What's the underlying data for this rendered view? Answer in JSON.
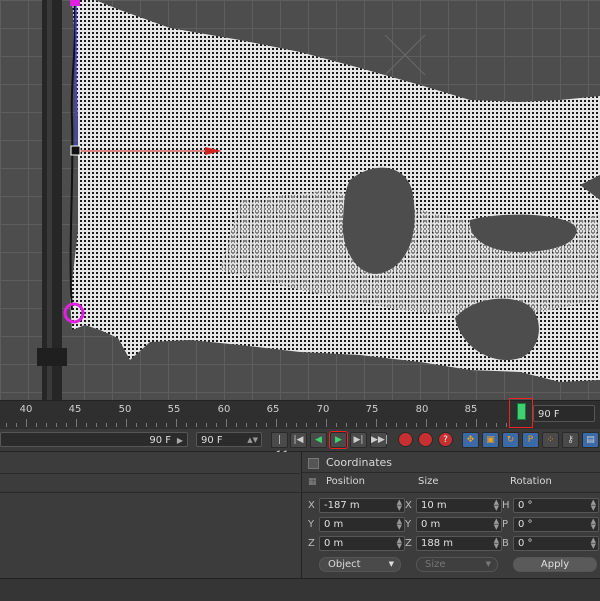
{
  "timeline": {
    "ticks": [
      "40",
      "45",
      "50",
      "55",
      "60",
      "65",
      "70",
      "75",
      "80",
      "85"
    ],
    "end_frame": "90 F"
  },
  "transport": {
    "preview_min": "90 F",
    "preview_max": "90 F"
  },
  "attributes": {
    "title": "Coordinates",
    "col_position": "Position",
    "col_size": "Size",
    "col_rotation": "Rotation",
    "rows": [
      {
        "pos_axis": "X",
        "pos": "-187 m",
        "size_axis": "X",
        "size": "10 m",
        "rot_axis": "H",
        "rot": "0 °"
      },
      {
        "pos_axis": "Y",
        "pos": "0 m",
        "size_axis": "Y",
        "size": "0 m",
        "rot_axis": "P",
        "rot": "0 °"
      },
      {
        "pos_axis": "Z",
        "pos": "0 m",
        "size_axis": "Z",
        "size": "188 m",
        "rot_axis": "B",
        "rot": "0 °"
      }
    ],
    "mode_select": "Object",
    "size_select": "Size",
    "apply_label": "Apply"
  },
  "colors": {
    "key": "#3fd070",
    "highlight": "#e22222",
    "magenta": "#e020e0"
  }
}
